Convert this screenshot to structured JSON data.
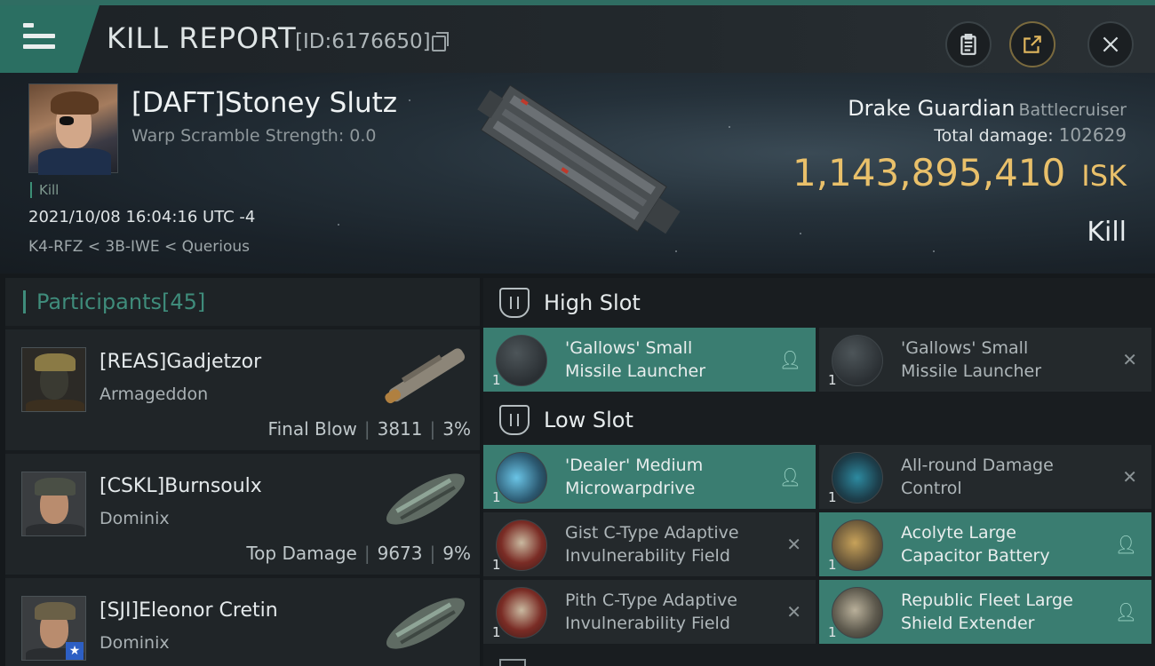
{
  "header": {
    "title": "KILL REPORT",
    "report_id": "[ID:6176650]"
  },
  "victim": {
    "name": "[DAFT]Stoney Slutz",
    "warp_scramble": "Warp Scramble Strength: 0.0",
    "tag": "Kill",
    "datetime": "2021/10/08 16:04:16 UTC -4",
    "location": "K4-RFZ < 3B-IWE < Querious",
    "ship_name": "Drake Guardian",
    "ship_class": "Battlecruiser",
    "total_damage_label": "Total damage:",
    "total_damage": "102629",
    "isk_value": "1,143,895,410",
    "isk_unit": "ISK",
    "report_type": "Kill"
  },
  "participants": {
    "label": "Participants",
    "count": "[45]",
    "rows": [
      {
        "name": "[REAS]Gadjetzor",
        "ship": "Armageddon",
        "role": "Final Blow",
        "damage": "3811",
        "percent": "3%"
      },
      {
        "name": "[CSKL]Burnsoulx",
        "ship": "Dominix",
        "role": "Top Damage",
        "damage": "9673",
        "percent": "9%"
      },
      {
        "name": "[SJI]Eleonor Cretin",
        "ship": "Dominix",
        "role": "",
        "damage": "",
        "percent": ""
      }
    ]
  },
  "fitting": {
    "high_slot_label": "High Slot",
    "low_slot_label": "Low Slot",
    "high": [
      {
        "qty": "1",
        "line1": "'Gallows' Small",
        "line2": "Missile Launcher",
        "status": "dropped"
      },
      {
        "qty": "1",
        "line1": "'Gallows' Small",
        "line2": "Missile Launcher",
        "status": "destroyed"
      }
    ],
    "low": [
      {
        "qty": "1",
        "line1": "'Dealer' Medium",
        "line2": "Microwarpdrive",
        "status": "dropped"
      },
      {
        "qty": "1",
        "line1": "All-round Damage",
        "line2": "Control",
        "status": "destroyed"
      },
      {
        "qty": "1",
        "line1": "Gist C-Type Adaptive",
        "line2": "Invulnerability Field",
        "status": "destroyed"
      },
      {
        "qty": "1",
        "line1": "Acolyte Large",
        "line2": "Capacitor Battery",
        "status": "dropped"
      },
      {
        "qty": "1",
        "line1": "Pith C-Type Adaptive",
        "line2": "Invulnerability Field",
        "status": "destroyed"
      },
      {
        "qty": "1",
        "line1": "Republic Fleet Large",
        "line2": "Shield Extender",
        "status": "dropped"
      }
    ]
  },
  "colors": {
    "accent": "#3a7d71",
    "isk": "#e9c06a",
    "header_teal": "#2b6f62"
  },
  "icons": {
    "menu": "hamburger-icon",
    "copy": "copy-icon",
    "clipboard": "clipboard-icon",
    "share": "share-icon",
    "close": "close-icon",
    "dropped": "person-icon",
    "destroyed": "x-icon"
  }
}
